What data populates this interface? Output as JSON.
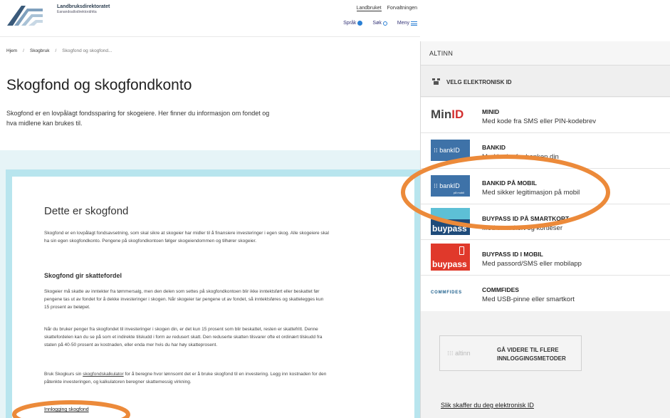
{
  "header": {
    "logo_line1": "Landbruksdirektoratet",
    "logo_line2": "Eanandoallodirektoráhtta",
    "top_links": [
      "Landbruket",
      "Forvaltningen"
    ],
    "menu": {
      "language": "Språk",
      "search": "Søk",
      "menu": "Meny"
    }
  },
  "breadcrumb": [
    "Hjem",
    "Skogbruk",
    "Skogfond og skogfond..."
  ],
  "page": {
    "title": "Skogfond og skogfondkonto",
    "lead": "Skogfond er en lovpålagt fondssparing for skogeiere. Her finner du informasjon om fondet og hva midlene kan brukes til."
  },
  "card": {
    "heading": "Dette er skogfond",
    "p1": "Skogfond er en lovpålagt fondsavsetning, som skal sikre at skogeier har midler til å finansiere investeringer i egen skog. Alle skogeiere skal ha sin egen skogfondkonto. Pengene på skogfondkontoen følger skogeiendommen og tilhører skogeier.",
    "subheading": "Skogfond gir skattefordel",
    "p2": "Skogeier må skatte av inntekter fra tømmersalg, men den delen som settes på skogfondkontoen blir ikke inntektsført eller beskattet før pengene tas ut av fondet for å dekke investeringer i skogen. Når skogeier tar pengene ut av fondet, så inntektsføres og skattelegges kun 15 prosent av beløpet.",
    "p3": "Når du bruker penger fra skogfondet til investeringer i skogen din, er det kun 15 prosent som blir beskattet, resten er skattefritt. Denne skattefordelen kan du se på som et indirekte tilskudd i form av redusert skatt. Den reduserte skatten tilsvarer ofte et ordinært tilskudd fra staten på 40-50 prosent av kostnaden, eller enda mer hvis du har høy skatteprosent.",
    "p4_pre": "Bruk Skogkurs sin ",
    "p4_link": "skogfondskalkulator",
    "p4_post": " for å beregne hvor lønnsomt det er å bruke skogfond til en investering. Legg inn kostnaden for den påtenkte investeringen, og kalkulatoren beregner skattemessig virkning.",
    "login_link": "Innlogging skogfond"
  },
  "panel": {
    "header": "ALTINN",
    "choose": "VELG ELEKTRONISK ID",
    "options": [
      {
        "logo": "MinID",
        "title": "MINID",
        "desc": "Med kode fra SMS eller PIN-kodebrev"
      },
      {
        "logo": "bankID",
        "title": "BANKID",
        "desc": "Med koder fra banken din"
      },
      {
        "logo": "bankID",
        "logo_sub": "på mobil",
        "title": "BANKID PÅ MOBIL",
        "desc": "Med sikker legitimasjon på mobil"
      },
      {
        "logo": "buypass",
        "title": "BUYPASS ID PÅ SMARTKORT",
        "desc": "Med smartkort og kortleser"
      },
      {
        "logo": "buypass",
        "title": "BUYPASS ID I MOBIL",
        "desc": "Med passord/SMS eller mobilapp"
      },
      {
        "logo": "COMMFIDES",
        "title": "COMMFIDES",
        "desc": "Med USB-pinne eller smartkort"
      }
    ],
    "more_logo": "altinn",
    "more_button": "GÅ VIDERE TIL FLERE INNLOGGINGSMETODER",
    "how_link": "Slik skaffer du deg elektronisk ID"
  },
  "colors": {
    "accent": "#2a7fd4",
    "annotation": "#ec8a3a",
    "band": "#e6f4f7",
    "bankid": "#3e72a8"
  }
}
